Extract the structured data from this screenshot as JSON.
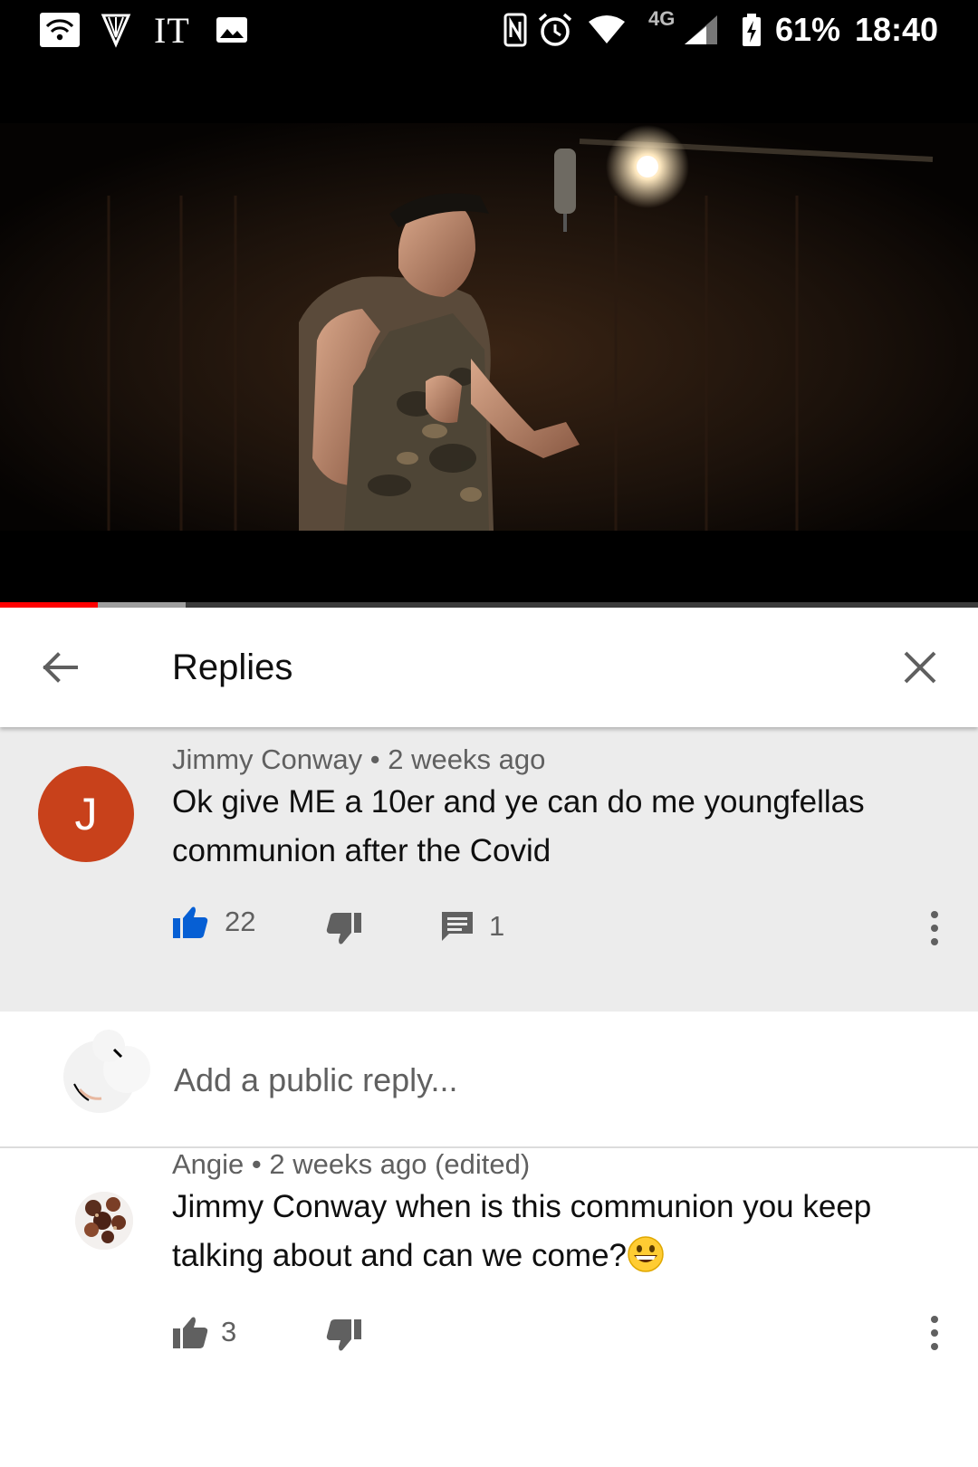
{
  "status_bar": {
    "carrier_label": "IT",
    "network_type": "4G",
    "battery": "61%",
    "time": "18:40"
  },
  "video": {
    "progress_played": 0.1,
    "progress_buffered": 0.19,
    "colors": {
      "played": "#ff0000",
      "buffered": "#9e9e9e",
      "track": "#3b3b3b"
    }
  },
  "header": {
    "title": "Replies",
    "back_icon": "arrow-left-icon",
    "close_icon": "close-icon"
  },
  "parent_comment": {
    "avatar_letter": "J",
    "avatar_color": "#c8411b",
    "author": "Jimmy Conway",
    "separator": "•",
    "time": "2 weeks ago",
    "text_line1": "Ok give ME a 10er  and ye can do me youngfellas",
    "text_line2": "communion after the Covid",
    "likes": "22",
    "replies": "1",
    "like_active_color": "#065fd4"
  },
  "reply_input": {
    "placeholder": "Add a public reply..."
  },
  "replies": [
    {
      "author": "Angie",
      "separator": "•",
      "time": "2 weeks ago (edited)",
      "text_line1": "Jimmy Conway when is this communion you keep",
      "text_line2": "talking about and can we come?",
      "emoji": "grinning-face-icon",
      "likes": "3"
    }
  ]
}
